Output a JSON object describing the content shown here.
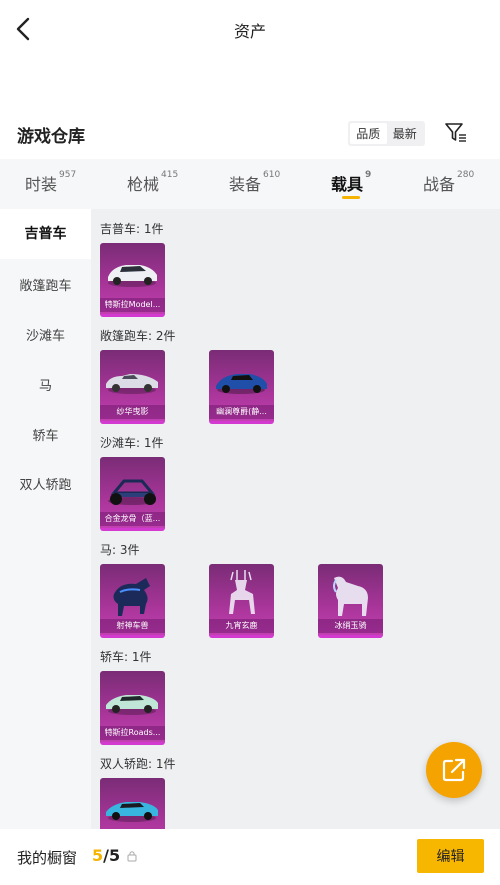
{
  "header": {
    "title": "资产"
  },
  "warehouse": {
    "title": "游戏仓库",
    "sort_options": [
      "品质",
      "最新"
    ],
    "sort_selected": "品质"
  },
  "tabs": [
    {
      "label": "时装",
      "count": "957"
    },
    {
      "label": "枪械",
      "count": "415"
    },
    {
      "label": "装备",
      "count": "610"
    },
    {
      "label": "载具",
      "count": "9",
      "active": true
    },
    {
      "label": "战备",
      "count": "280"
    }
  ],
  "sidebar": {
    "items": [
      {
        "label": "吉普车",
        "active": true
      },
      {
        "label": "敞篷跑车"
      },
      {
        "label": "沙滩车"
      },
      {
        "label": "马"
      },
      {
        "label": "轿车"
      },
      {
        "label": "双人轿跑"
      }
    ]
  },
  "groups": [
    {
      "label": "吉普车: 1件",
      "items": [
        {
          "name": "特斯拉Model...",
          "icon": "white-sedan"
        }
      ]
    },
    {
      "label": "敞篷跑车: 2件",
      "items": [
        {
          "name": "纱华曳影",
          "icon": "white-convertible"
        },
        {
          "name": "幽澜尊爵(静...",
          "icon": "blue-sportscar"
        }
      ]
    },
    {
      "label": "沙滩车: 1件",
      "items": [
        {
          "name": "合金龙骨（蓝...",
          "icon": "dune-buggy"
        }
      ]
    },
    {
      "label": "马: 3件",
      "items": [
        {
          "name": "射神车兽",
          "icon": "armored-horse"
        },
        {
          "name": "九宵玄鹿",
          "icon": "crystal-deer"
        },
        {
          "name": "冰绡玉骑",
          "icon": "crystal-horse"
        }
      ]
    },
    {
      "label": "轿车: 1件",
      "items": [
        {
          "name": "特斯拉Roads...",
          "icon": "mint-roadster"
        }
      ]
    },
    {
      "label": "双人轿跑: 1件",
      "items": [
        {
          "name": "",
          "icon": "cyan-coupe"
        }
      ]
    }
  ],
  "footer": {
    "window_label": "我的橱窗",
    "window_current": "5",
    "window_total": "/5",
    "edit_label": "编辑"
  },
  "colors": {
    "accent": "#f5b400",
    "card": "#a83599",
    "fab": "#f5a300"
  }
}
